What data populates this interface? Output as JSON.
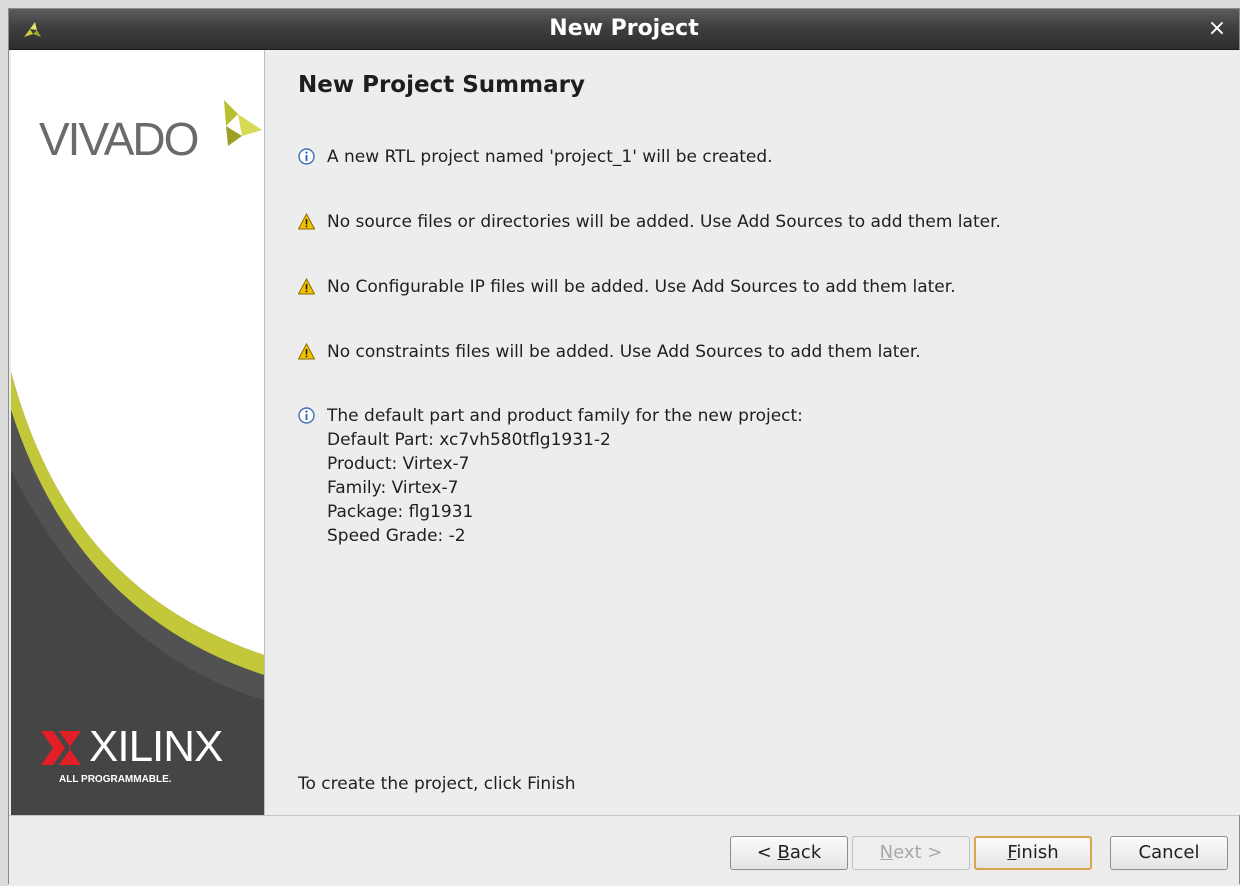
{
  "window": {
    "title": "New Project",
    "close_glyph": "×"
  },
  "side_panel": {
    "vivado_logo_text": "VIVADO",
    "xilinx_logo_text": "XILINX",
    "xilinx_tagline": "ALL PROGRAMMABLE.",
    "colors": {
      "accent": "#c4cc3a",
      "dark": "#4a4a4a"
    }
  },
  "summary": {
    "heading": "New Project Summary",
    "messages": [
      {
        "type": "info",
        "icon": "info-icon",
        "text": "A new RTL project named 'project_1' will be created."
      },
      {
        "type": "warning",
        "icon": "warning-icon",
        "text": "No source files or directories will be added. Use Add Sources to add them later."
      },
      {
        "type": "warning",
        "icon": "warning-icon",
        "text": "No Configurable IP files will be added. Use Add Sources to add them later."
      },
      {
        "type": "warning",
        "icon": "warning-icon",
        "text": "No constraints files will be added. Use Add Sources to add them later."
      },
      {
        "type": "info",
        "icon": "info-icon",
        "text": "The default part and product family for the new project:"
      }
    ],
    "part_details": [
      "Default Part: xc7vh580tflg1931-2",
      "Product: Virtex-7",
      "Family: Virtex-7",
      "Package: flg1931",
      "Speed Grade: -2"
    ],
    "finish_hint": "To create the project, click Finish"
  },
  "buttons": {
    "back": {
      "mnemonic": "B",
      "rest": "ack",
      "prefix": "< "
    },
    "next": {
      "mnemonic": "N",
      "rest": "ext",
      "suffix": " >",
      "enabled": false
    },
    "finish": {
      "mnemonic": "F",
      "rest": "inish"
    },
    "cancel": {
      "label": "Cancel"
    }
  }
}
